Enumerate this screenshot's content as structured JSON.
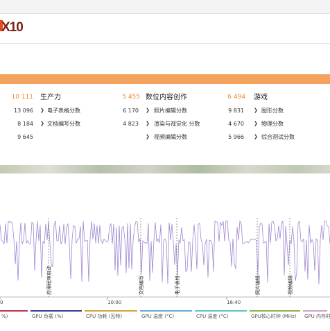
{
  "header": {
    "logo_text": "X10"
  },
  "scores": [
    {
      "total": "10 111",
      "title": "生产力",
      "items": [
        {
          "value": "13 096",
          "label": "电子表格分数"
        },
        {
          "value": "8 184",
          "label": "文档编写分数"
        },
        {
          "value": "9 645",
          "label": ""
        }
      ]
    },
    {
      "total": "5 455",
      "title": "数位内容创作",
      "items": [
        {
          "value": "6 170",
          "label": "照片编辑分数"
        },
        {
          "value": "4 823",
          "label": "渲染与视觉化 分数"
        },
        {
          "value": "",
          "label": "视频编辑分数"
        }
      ]
    },
    {
      "total": "6 494",
      "title": "游戏",
      "items": [
        {
          "value": "9 831",
          "label": "图形分数"
        },
        {
          "value": "4 670",
          "label": "物理分数"
        },
        {
          "value": "5 966",
          "label": "综合测试分数"
        }
      ]
    }
  ],
  "chart_data": {
    "type": "line",
    "x_tick_labels": [
      "0",
      "10:00",
      "16:40"
    ],
    "annotations": [
      "应用程序启动",
      "文档编写",
      "电子表格",
      "照片编辑",
      "视频编辑"
    ],
    "series_color": "#9b7fd0",
    "legend": [
      {
        "name": "%)",
        "color": "#c0304a"
      },
      {
        "name": "GPU 负载 (%)",
        "color": "#3a3f8f"
      },
      {
        "name": "CPU 功耗 (瓦特)",
        "color": "#d4a43a"
      },
      {
        "name": "GPU 温度 (°C)",
        "color": "#6aa8d8"
      },
      {
        "name": "CPU 温度 (°C)",
        "color": "#5cc6b8"
      },
      {
        "name": "GPU核心时钟 (MHz)",
        "color": "#8fb04a"
      },
      {
        "name": "GPU 内存时",
        "color": "#d0a0c8"
      }
    ]
  }
}
